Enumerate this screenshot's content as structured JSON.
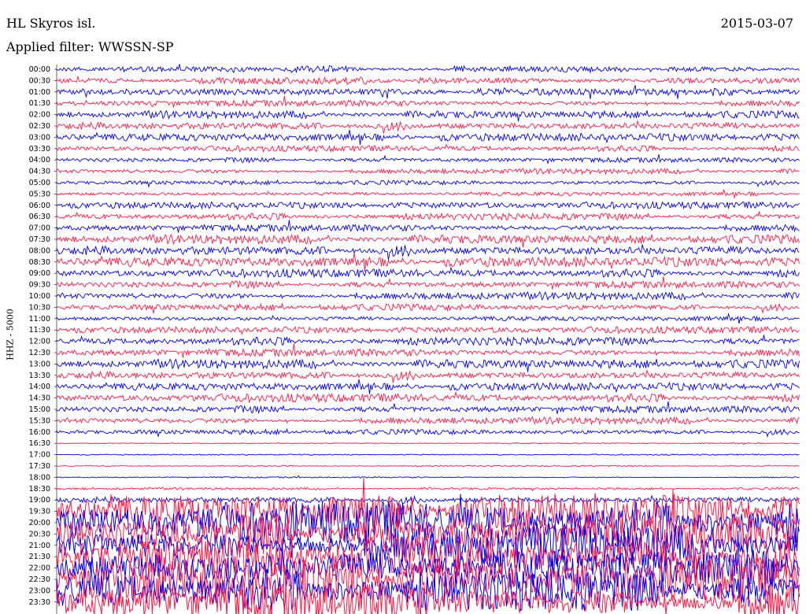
{
  "header": {
    "station": "HL Skyros isl.",
    "date": "2015-03-07",
    "filter": "Applied filter: WWSSN-SP"
  },
  "colors": {
    "series_a": "#0000ee",
    "series_b": "#ff1744"
  },
  "chart_data": {
    "type": "line",
    "ylabel": "HHZ - 5000",
    "xlabel": "",
    "color_cycle": [
      "#0000ee",
      "#ff1744"
    ],
    "tick_labels": [
      "00:00",
      "00:30",
      "01:00",
      "01:30",
      "02:00",
      "02:30",
      "03:00",
      "03:30",
      "04:00",
      "04:30",
      "05:00",
      "05:30",
      "06:00",
      "06:30",
      "07:00",
      "07:30",
      "08:00",
      "08:30",
      "09:00",
      "09:30",
      "10:00",
      "10:30",
      "11:00",
      "11:30",
      "12:00",
      "12:30",
      "13:00",
      "13:30",
      "14:00",
      "14:30",
      "15:00",
      "15:30",
      "16:00",
      "16:30",
      "17:00",
      "17:30",
      "18:00",
      "18:30",
      "19:00",
      "19:30",
      "20:00",
      "20:30",
      "21:00",
      "21:30",
      "22:00",
      "22:30",
      "23:00",
      "23:30"
    ],
    "relative_amplitude": [
      0.45,
      0.5,
      0.55,
      0.45,
      0.5,
      0.6,
      0.55,
      0.4,
      0.35,
      0.35,
      0.3,
      0.3,
      0.45,
      0.45,
      0.5,
      0.6,
      0.75,
      0.7,
      0.55,
      0.5,
      0.5,
      0.45,
      0.35,
      0.45,
      0.55,
      0.55,
      0.6,
      0.6,
      0.55,
      0.55,
      0.5,
      0.45,
      0.35,
      0.08,
      0.08,
      0.08,
      0.1,
      0.15,
      0.5,
      2.5,
      2.8,
      2.8,
      2.8,
      2.8,
      2.8,
      2.8,
      2.8,
      2.8
    ],
    "grid": false,
    "legend": "none"
  }
}
